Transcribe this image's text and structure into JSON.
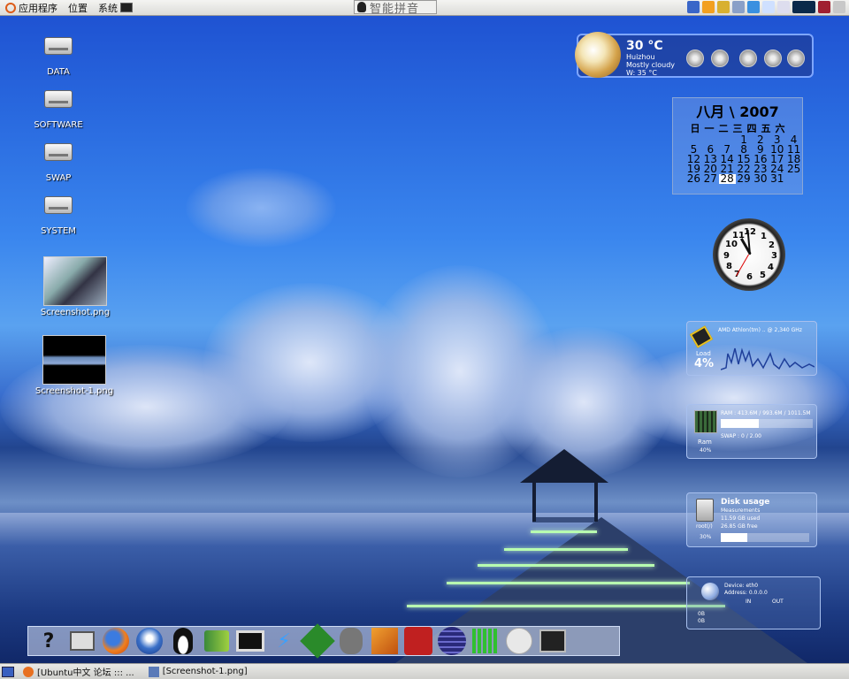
{
  "top_panel": {
    "menus": [
      "应用程序",
      "位置",
      "系统"
    ],
    "ime_label": "智能拼音"
  },
  "desktop_icons": [
    {
      "label": "DATA",
      "icon": "drive-icon"
    },
    {
      "label": "SOFTWARE",
      "icon": "drive-icon"
    },
    {
      "label": "SWAP",
      "icon": "drive-icon"
    },
    {
      "label": "SYSTEM",
      "icon": "drive-icon"
    },
    {
      "label": "Screenshot.png",
      "icon": "image-thumbnail"
    },
    {
      "label": "Screenshot-1.png",
      "icon": "image-thumbnail"
    }
  ],
  "weather": {
    "temp": "30 °C",
    "city": "Huizhou",
    "condition": "Mostly cloudy",
    "wind": "W: 35 °C"
  },
  "calendar": {
    "header": "八月 \\ 2007",
    "weekdays": [
      "日",
      "一",
      "二",
      "三",
      "四",
      "五",
      "六"
    ],
    "weeks": [
      [
        "",
        "",
        "",
        "1",
        "2",
        "3",
        "4"
      ],
      [
        "5",
        "6",
        "7",
        "8",
        "9",
        "10",
        "11"
      ],
      [
        "12",
        "13",
        "14",
        "15",
        "16",
        "17",
        "18"
      ],
      [
        "19",
        "20",
        "21",
        "22",
        "23",
        "24",
        "25"
      ],
      [
        "26",
        "27",
        "28",
        "29",
        "30",
        "31",
        ""
      ]
    ],
    "today": "28"
  },
  "clock": {
    "numbers": [
      "12",
      "1",
      "2",
      "3",
      "4",
      "5",
      "6",
      "7",
      "8",
      "9",
      "10",
      "11"
    ]
  },
  "cpu_monitor": {
    "title": "AMD Athlon(tm) .. @ 2,340 GHz",
    "label": "Load",
    "value": "4%"
  },
  "ram_monitor": {
    "ram_text": "RAM : 413.6M / 993.6M / 1011.5M",
    "swap_text": "SWAP : 0 / 2.00",
    "label": "Ram",
    "percent": "40%",
    "ram_fill": 0.41
  },
  "disk_monitor": {
    "title": "Disk usage",
    "subtitle": "Measurements",
    "used": "11.59 GB used",
    "free": "26.85 GB free",
    "mount": "root(/)",
    "percent": "30%",
    "fill": 0.3
  },
  "net_monitor": {
    "device": "Device: eth0",
    "address": "Address: 0.0.0.0",
    "in_label": "IN",
    "out_label": "OUT",
    "in_value": "0B",
    "out_value": "0B",
    "in_total": "0B",
    "out_total": "0B"
  },
  "dock_items": [
    "help-icon",
    "computer-icon",
    "firefox-icon",
    "thunderbird-icon",
    "qq-icon",
    "books-icon",
    "monitor-icon",
    "flash-icon",
    "vim-icon",
    "gimp-icon",
    "package-icon",
    "debian-icon",
    "eclipse-icon",
    "equalizer-icon",
    "arrow-icon",
    "terminal-icon"
  ],
  "bottom_panel": {
    "tasks": [
      "[Ubuntu中文 论坛 ::: ...",
      "[Screenshot-1.png]"
    ]
  }
}
